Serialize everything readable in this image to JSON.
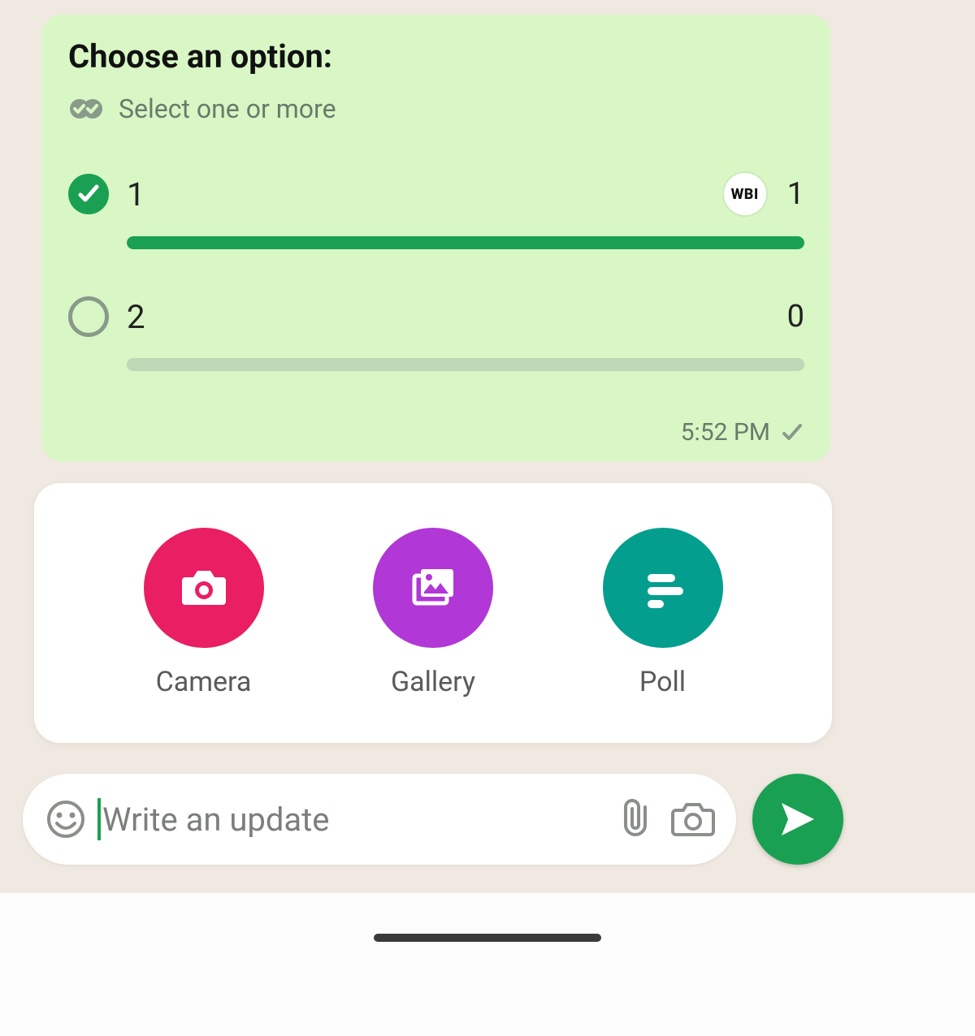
{
  "poll": {
    "title": "Choose an option:",
    "subtitle": "Select one or more",
    "timestamp": "5:52 PM",
    "options": [
      {
        "label": "1",
        "votes": "1",
        "selected": true,
        "percent": 100,
        "avatar": "WBI"
      },
      {
        "label": "2",
        "votes": "0",
        "selected": false,
        "percent": 0
      }
    ]
  },
  "attachments": {
    "camera": {
      "label": "Camera"
    },
    "gallery": {
      "label": "Gallery"
    },
    "poll": {
      "label": "Poll"
    }
  },
  "composer": {
    "placeholder": "Write an update"
  }
}
